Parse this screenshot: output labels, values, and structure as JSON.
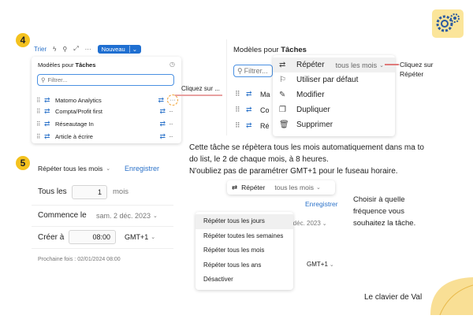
{
  "step4": {
    "number": "4",
    "toolbar": {
      "filter_label": "Trier",
      "new_button": "Nouveau"
    },
    "panel_title_prefix": "Modèles pour ",
    "panel_title_bold": "Tâches",
    "filter_placeholder": "Filtrer...",
    "items": [
      {
        "label": "Matomo Analytics"
      },
      {
        "label": "Compta/Profit first"
      },
      {
        "label": "Réseautage In"
      },
      {
        "label": "Article à écrire"
      }
    ],
    "callout": "Cliquez sur ..."
  },
  "context": {
    "panel_title_prefix": "Modèles pour ",
    "panel_title_bold": "Tâches",
    "filter_placeholder": "Filtrer...",
    "bg_items": [
      "Ma",
      "Co",
      "Ré"
    ],
    "menu": [
      {
        "icon": "repeat-icon",
        "label": "Répéter",
        "value": "tous les mois"
      },
      {
        "icon": "flag-icon",
        "label": "Utiliser par défaut"
      },
      {
        "icon": "edit-icon",
        "label": "Modifier"
      },
      {
        "icon": "copy-icon",
        "label": "Dupliquer"
      },
      {
        "icon": "trash-icon",
        "label": "Supprimer"
      }
    ],
    "callout_line1": "Cliquez sur",
    "callout_line2": "Répéter"
  },
  "explanation": {
    "line1": "Cette tâche se répètera tous les mois automatiquement dans ma to",
    "line2": "do list, le 2 de chaque mois, à 8 heures.",
    "line3": "N'oubliez pas de paramétrer GMT+1 pour le fuseau horaire."
  },
  "step5": {
    "number": "5",
    "repeat_label": "Répéter tous les mois",
    "save_button": "Enregistrer",
    "every_label": "Tous les",
    "every_value": "1",
    "every_unit": "mois",
    "start_label": "Commence le",
    "start_value": "sam. 2 déc. 2023",
    "create_label": "Créer à",
    "create_time": "08:00",
    "timezone": "GMT+1",
    "next_label": "Prochaine fois : 02/01/2024 08:00"
  },
  "dropdown": {
    "header_label": "Répéter",
    "header_value": "tous les mois",
    "save_button": "Enregistrer",
    "options": [
      "Répéter tous les jours",
      "Répéter toutes les semaines",
      "Répéter tous les mois",
      "Répéter tous les ans",
      "Désactiver"
    ],
    "bg_date": "2 déc. 2023",
    "bg_tz": "GMT+1"
  },
  "choose_text": {
    "line1": "Choisir à quelle",
    "line2": "fréquence vous",
    "line3": "souhaitez la tâche."
  },
  "signature": "Le clavier de Val",
  "colors": {
    "accent": "#2b72c9",
    "badge": "#f4c21f",
    "new_button": "#1f6fd1",
    "decor": "#f7d77a"
  }
}
